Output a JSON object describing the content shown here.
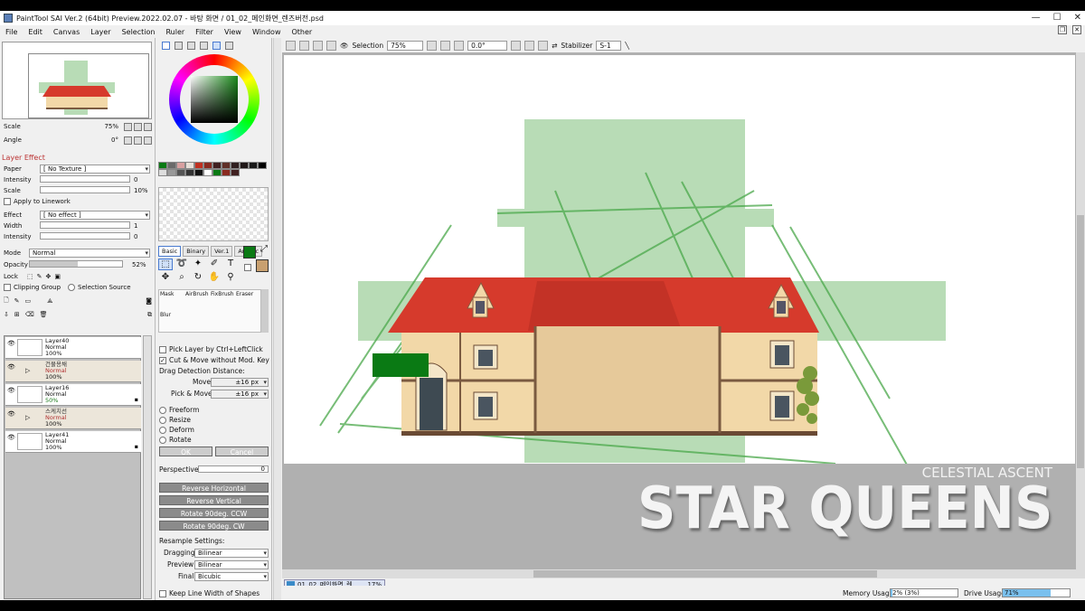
{
  "window": {
    "title": "PaintTool SAI Ver.2 (64bit) Preview.2022.02.07 - 바탕 화면 / 01_02_메인화면_렌즈버전.psd"
  },
  "menu": [
    "File",
    "Edit",
    "Canvas",
    "Layer",
    "Selection",
    "Ruler",
    "Filter",
    "View",
    "Window",
    "Other"
  ],
  "navigator": {
    "scale_label": "Scale",
    "scale_value": "75%",
    "angle_label": "Angle",
    "angle_value": "0°"
  },
  "layer_effect": {
    "title": "Layer Effect",
    "paper_label": "Paper",
    "paper_value": "[ No Texture ]",
    "intensity_label": "Intensity",
    "intensity_value": "0",
    "scale_label": "Scale",
    "scale_value": "10%",
    "apply_linework": "Apply to Linework",
    "effect_label": "Effect",
    "effect_value": "[ No effect ]",
    "width_label": "Width",
    "width_value": "1",
    "intensity2_label": "Intensity",
    "intensity2_value": "0"
  },
  "layer_props": {
    "mode_label": "Mode",
    "mode_value": "Normal",
    "opacity_label": "Opacity",
    "opacity_value": "52%",
    "opacity_fraction": 0.52,
    "lock_label": "Lock",
    "clipping_group": "Clipping Group",
    "selection_source": "Selection Source"
  },
  "layers": [
    {
      "name": "Layer40",
      "mode": "Normal",
      "opacity": "100%",
      "folder": false
    },
    {
      "name": "건물용채",
      "mode": "Normal",
      "opacity": "100%",
      "folder": true
    },
    {
      "name": "Layer16",
      "mode": "Normal",
      "opacity": "50%",
      "folder": false
    },
    {
      "name": "스케치선",
      "mode": "Normal",
      "opacity": "100%",
      "folder": true
    },
    {
      "name": "Layer41",
      "mode": "Normal",
      "opacity": "100%",
      "folder": false
    }
  ],
  "tool_tabs": [
    "Basic",
    "Binary",
    "Ver.1",
    "Artistic"
  ],
  "brush_tools": [
    "Mask",
    "AirBrush",
    "FixBrush",
    "Eraser",
    "Blur"
  ],
  "tool_options": {
    "pick_layer": "Pick Layer by Ctrl+LeftClick",
    "cut_move": "Cut & Move without Mod. Key",
    "drag_title": "Drag Detection Distance:",
    "move_label": "Move",
    "move_value": "±16 px",
    "pickmove_label": "Pick & Move",
    "pickmove_value": "±16 px",
    "freeform": "Freeform",
    "resize": "Resize",
    "deform": "Deform",
    "rotate": "Rotate",
    "ok": "OK",
    "cancel": "Cancel",
    "perspective_label": "Perspective",
    "perspective_value": "0",
    "reverse_h": "Reverse Horizontal",
    "reverse_v": "Reverse Vertical",
    "rot_ccw": "Rotate 90deg. CCW",
    "rot_cw": "Rotate 90deg. CW",
    "resample_title": "Resample Settings:",
    "dragging_label": "Dragging",
    "dragging_value": "Bilinear",
    "preview_label": "Preview",
    "preview_value": "Bilinear",
    "final_label": "Final",
    "final_value": "Bicubic",
    "keep_line": "Keep Line Width of Shapes"
  },
  "canvas_toolbar": {
    "selection_label": "Selection",
    "zoom": "75%",
    "angle": "0.0°",
    "stabilizer_label": "Stabilizer",
    "stabilizer_value": "S-1"
  },
  "doc_tab": {
    "name": "01_02_메인화면_렌...",
    "zoom": "17%"
  },
  "status": {
    "memory_label": "Memory Usage",
    "memory_value": "2% (3%)",
    "memory_fraction": 0.03,
    "drive_label": "Drive Usage",
    "drive_value": "71%",
    "drive_fraction": 0.71
  },
  "colors": {
    "accent": "#4a7bd0",
    "roof": "#d63a2c",
    "wall": "#f2d8a8",
    "sketch_green": "#b8dcb6",
    "brush_green": "#0a7a14"
  },
  "watermark": {
    "subtitle": "CELESTIAL ASCENT",
    "title": "STAR QUEENS"
  }
}
